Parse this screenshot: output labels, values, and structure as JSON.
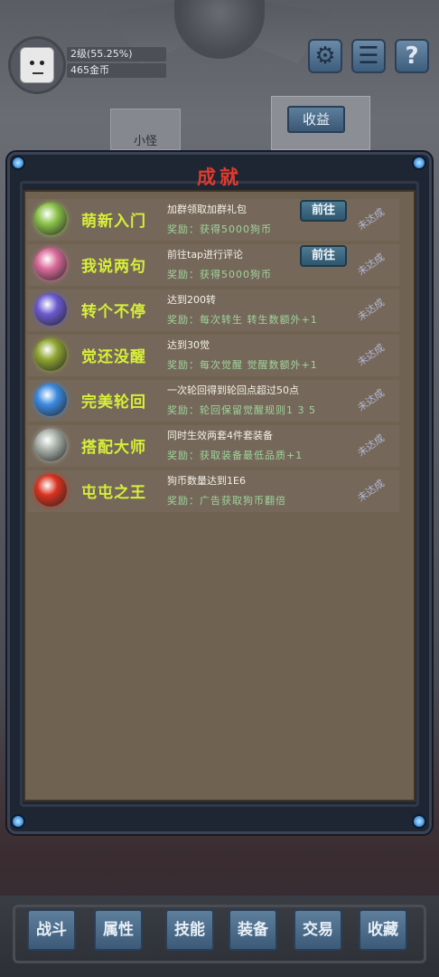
{
  "player": {
    "level_text": "2级(55.25%)",
    "gold_text": "465金币",
    "level_progress_percent": 55.25
  },
  "header_buttons": [
    {
      "icon": "gear-icon",
      "glyph": "⚙"
    },
    {
      "icon": "menu-icon",
      "glyph": "☰"
    },
    {
      "icon": "help-icon",
      "glyph": "?"
    }
  ],
  "tabs": {
    "small": "小怪",
    "big": "收益"
  },
  "panel": {
    "title": "成就"
  },
  "achievements": [
    {
      "name": "萌新入门",
      "desc": "加群领取加群礼包",
      "reward": "奖励：获得5000狗币",
      "go": "前往",
      "status": "未达成",
      "icon": "green-orb-icon",
      "color": "#8bc34a"
    },
    {
      "name": "我说两句",
      "desc": "前往tap进行评论",
      "reward": "奖励：获得5000狗币",
      "go": "前往",
      "status": "未达成",
      "icon": "pink-orb-icon",
      "color": "#d96a9a"
    },
    {
      "name": "转个不停",
      "desc": "达到200转",
      "reward": "奖励：每次转生 转生数额外+1",
      "go": "",
      "status": "未达成",
      "icon": "purple-orb-icon",
      "color": "#6a5ad0"
    },
    {
      "name": "觉还没醒",
      "desc": "达到30觉",
      "reward": "奖励：每次觉醒 觉醒数额外+1",
      "go": "",
      "status": "未达成",
      "icon": "olive-orb-icon",
      "color": "#8fa530"
    },
    {
      "name": "完美轮回",
      "desc": "一次轮回得到轮回点超过50点",
      "reward": "奖励：轮回保留觉醒规则1 3 5",
      "go": "",
      "status": "未达成",
      "icon": "blue-orb-icon",
      "color": "#3a8ae0"
    },
    {
      "name": "搭配大师",
      "desc": "同时生效两套4件套装备",
      "reward": "奖励：获取装备最低品质+1",
      "go": "",
      "status": "未达成",
      "icon": "silver-orb-icon",
      "color": "#a8b0a8"
    },
    {
      "name": "屯屯之王",
      "desc": "狗币数量达到1E6",
      "reward": "奖励：广告获取狗币翻倍",
      "go": "",
      "status": "未达成",
      "icon": "red-orb-icon",
      "color": "#d8321e"
    }
  ],
  "bottom_nav": [
    "战斗",
    "属性",
    "技能",
    "装备",
    "交易",
    "收藏"
  ]
}
